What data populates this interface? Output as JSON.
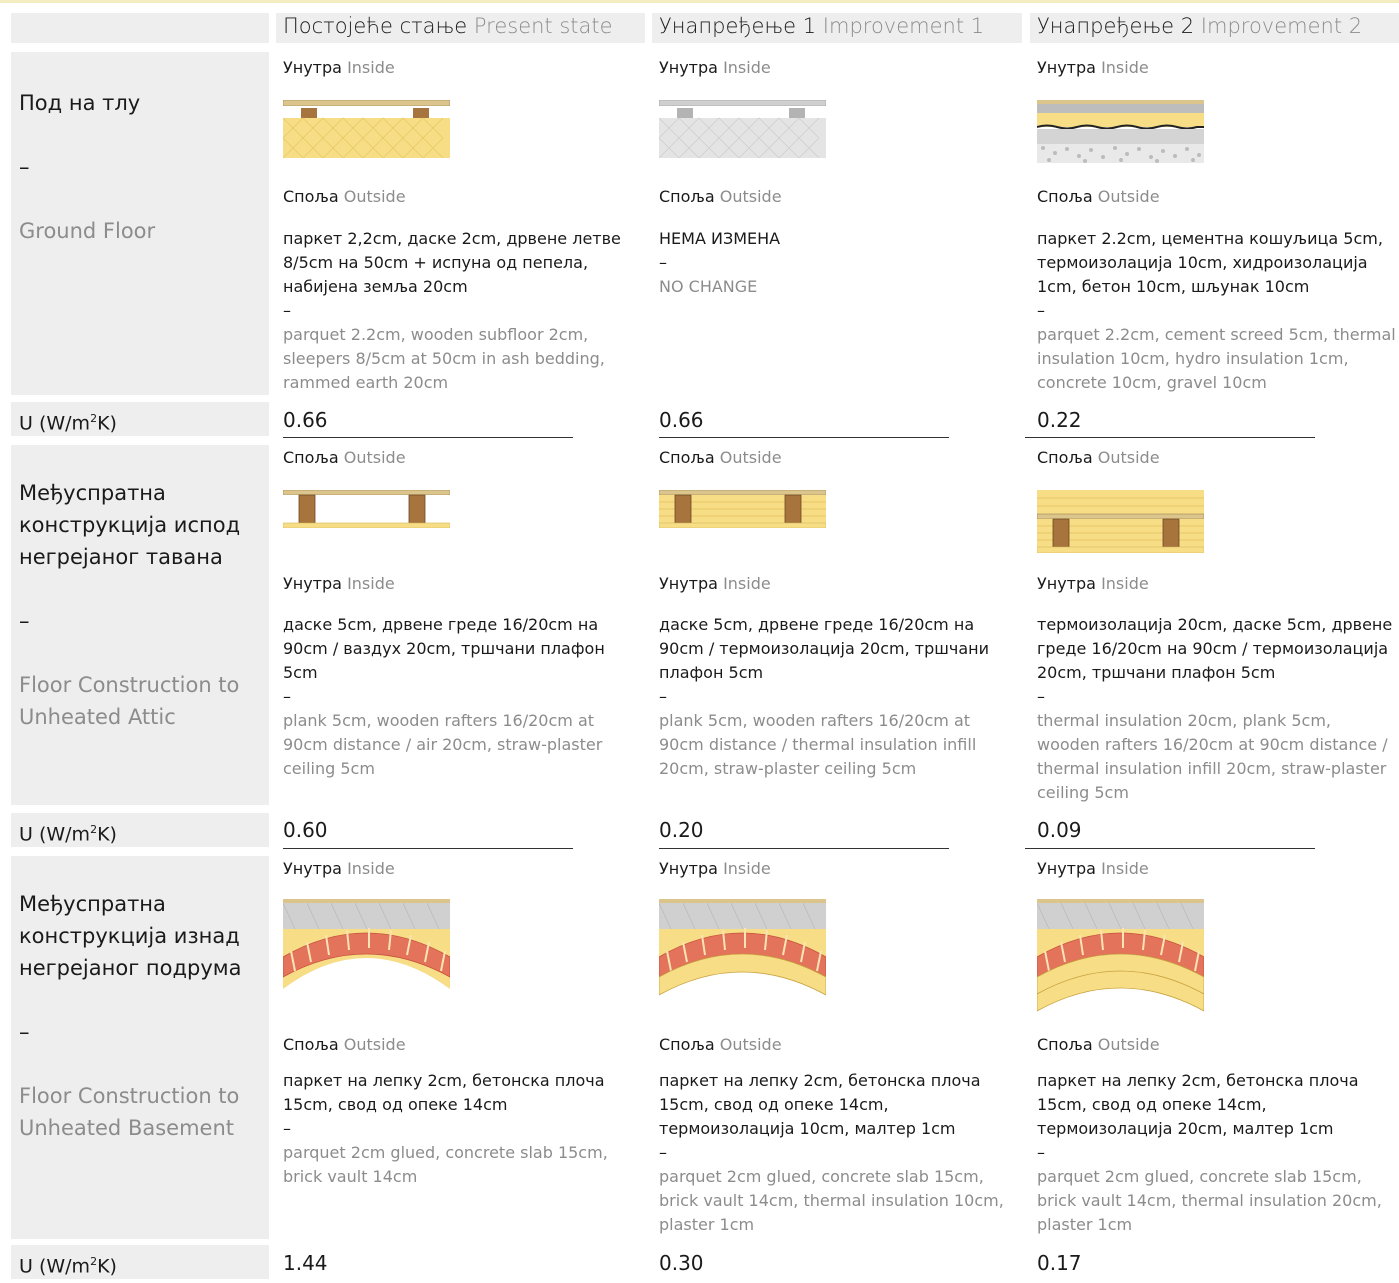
{
  "header": {
    "col1": {
      "sr": "Постојеће стање",
      "en": "Present state"
    },
    "col2": {
      "sr": "Унапређење 1",
      "en": "Improvement 1"
    },
    "col3": {
      "sr": "Унапређење 2",
      "en": "Improvement 2"
    }
  },
  "labels": {
    "inside_sr": "Унутра",
    "inside_en": "Inside",
    "outside_sr": "Споља",
    "outside_en": "Outside",
    "u_main": "U (W/m",
    "u_sup": "2",
    "u_tail": "K)",
    "dash": "–"
  },
  "rows": {
    "ground": {
      "label_sr": "Под на тлу",
      "label_en": "Ground Floor",
      "c1": {
        "sr": "паркет 2,2cm, даске 2cm, дрвене летве 8/5cm на 50cm + испуна од пепела, набијена земља 20cm",
        "en": "parquet 2.2cm, wooden subfloor 2cm, sleepers 8/5cm at 50cm in ash bedding, rammed earth 20cm",
        "u": "0.66"
      },
      "c2": {
        "sr": "НЕМА ИЗМЕНА",
        "en": "NO CHANGE",
        "u": "0.66"
      },
      "c3": {
        "sr": "паркет 2.2cm, цементна кошуљица 5cm, термоизолација 10cm, хидроизолација 1cm, бетон 10cm, шљунак 10cm",
        "en": "parquet 2.2cm, cement screed 5cm, thermal insulation 10cm, hydro insulation 1cm, concrete 10cm, gravel 10cm",
        "u": "0.22"
      }
    },
    "attic": {
      "label_sr": "Међуспратна конструкција испод негрејаног тавана",
      "label_en": "Floor Construction to Unheated Attic",
      "c1": {
        "sr": "даске 5cm, дрвене греде 16/20cm на 90cm / ваздух 20cm, тршчани плафон 5cm",
        "en": "plank 5cm, wooden rafters 16/20cm at 90cm distance / air 20cm, straw-plaster ceiling 5cm",
        "u": "0.60"
      },
      "c2": {
        "sr": "даске 5cm, дрвене греде 16/20cm на 90cm / термоизолација 20cm, тршчани плафон 5cm",
        "en": "plank 5cm, wooden rafters 16/20cm at 90cm distance / thermal insulation infill 20cm, straw-plaster ceiling 5cm",
        "u": "0.20"
      },
      "c3": {
        "sr": "термоизолација 20cm, даске 5cm, дрвене греде 16/20cm на 90cm / термоизолација 20cm, тршчани плафон 5cm",
        "en": "thermal insulation 20cm, plank 5cm, wooden rafters 16/20cm at 90cm distance / thermal insulation infill 20cm, straw-plaster ceiling 5cm",
        "u": "0.09"
      }
    },
    "basement": {
      "label_sr": "Међуспратна конструкција изнад негрејаног подрума",
      "label_en": "Floor Construction to Unheated Basement",
      "c1": {
        "sr": "паркет на лепку 2cm, бетонска плоча 15cm, свод од опеке 14cm",
        "en": "parquet 2cm glued, concrete slab 15cm, brick vault 14cm",
        "u": "1.44"
      },
      "c2": {
        "sr": "паркет на лепку 2cm, бетонска плоча 15cm, свод од опеке 14cm, термоизолација 10cm, малтер 1cm",
        "en": "parquet 2cm glued, concrete slab 15cm, brick vault 14cm, thermal insulation 10cm, plaster 1cm",
        "u": "0.30"
      },
      "c3": {
        "sr": "паркет на лепку 2cm, бетонска плоча 15cm, свод од опеке 14cm, термоизолација 20cm, малтер 1cm",
        "en": "parquet 2cm glued, concrete slab 15cm, brick vault 14cm, thermal insulation 20cm, plaster 1cm",
        "u": "0.17"
      }
    }
  },
  "colors": {
    "insulation": "#f6dd86",
    "timber": "#a8743e",
    "concrete": "#c8c8c8",
    "brick": "#e3735a",
    "header_bg": "#eeeeee"
  }
}
